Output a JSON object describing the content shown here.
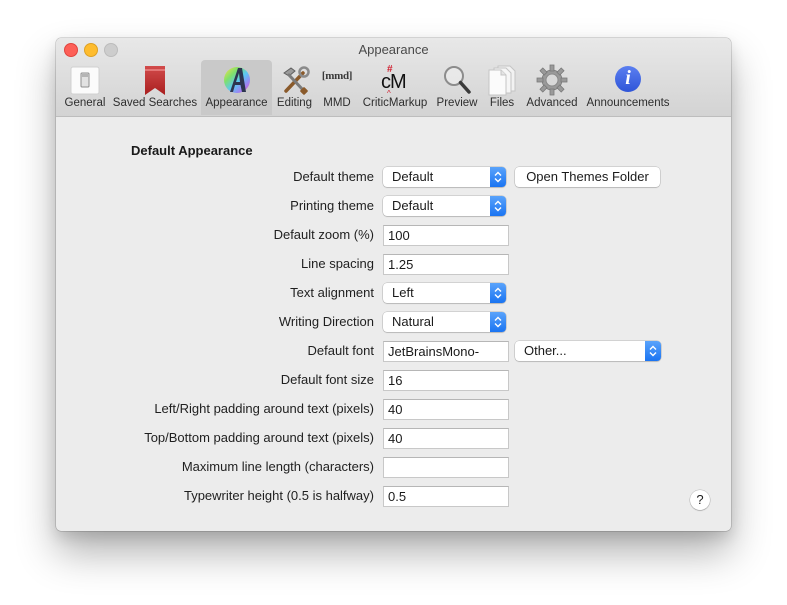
{
  "window": {
    "title": "Appearance"
  },
  "toolbar": {
    "items": [
      {
        "label": "General",
        "icon": "general-switch-icon",
        "selected": false
      },
      {
        "label": "Saved Searches",
        "icon": "bookmark-icon",
        "selected": false
      },
      {
        "label": "Appearance",
        "icon": "color-wheel-a-icon",
        "selected": true
      },
      {
        "label": "Editing",
        "icon": "hammer-wrench-icon",
        "selected": false
      },
      {
        "label": "MMD",
        "icon": "mmd-icon",
        "selected": false
      },
      {
        "label": "CriticMarkup",
        "icon": "criticmarkup-icon",
        "selected": false
      },
      {
        "label": "Preview",
        "icon": "magnifier-icon",
        "selected": false
      },
      {
        "label": "Files",
        "icon": "files-icon",
        "selected": false
      },
      {
        "label": "Advanced",
        "icon": "gear-icon",
        "selected": false
      },
      {
        "label": "Announcements",
        "icon": "info-icon",
        "selected": false
      }
    ],
    "mmd_glyph": "[mmd]",
    "cm_glyph": "cM",
    "info_glyph": "i"
  },
  "section": {
    "title": "Default Appearance"
  },
  "settings": {
    "default_theme": {
      "label": "Default theme",
      "value": "Default"
    },
    "open_themes_folder": "Open Themes Folder",
    "printing_theme": {
      "label": "Printing theme",
      "value": "Default"
    },
    "default_zoom": {
      "label": "Default zoom (%)",
      "value": "100"
    },
    "line_spacing": {
      "label": "Line spacing",
      "value": "1.25"
    },
    "text_alignment": {
      "label": "Text alignment",
      "value": "Left"
    },
    "writing_direction": {
      "label": "Writing Direction",
      "value": "Natural"
    },
    "default_font": {
      "label": "Default font",
      "value": "JetBrainsMono-",
      "picker_value": "Other..."
    },
    "default_font_size": {
      "label": "Default font size",
      "value": "16"
    },
    "lr_padding": {
      "label": "Left/Right padding around text (pixels)",
      "value": "40"
    },
    "tb_padding": {
      "label": "Top/Bottom padding around text (pixels)",
      "value": "40"
    },
    "max_line_length": {
      "label": "Maximum line length (characters)",
      "value": ""
    },
    "typewriter_height": {
      "label": "Typewriter height (0.5 is halfway)",
      "value": "0.5"
    }
  },
  "help": {
    "label": "?"
  },
  "colors": {
    "accent": "#1a74f2",
    "close": "#fd5f57",
    "minimize": "#febc2e",
    "zoom_disabled": "#cdcdcd"
  }
}
